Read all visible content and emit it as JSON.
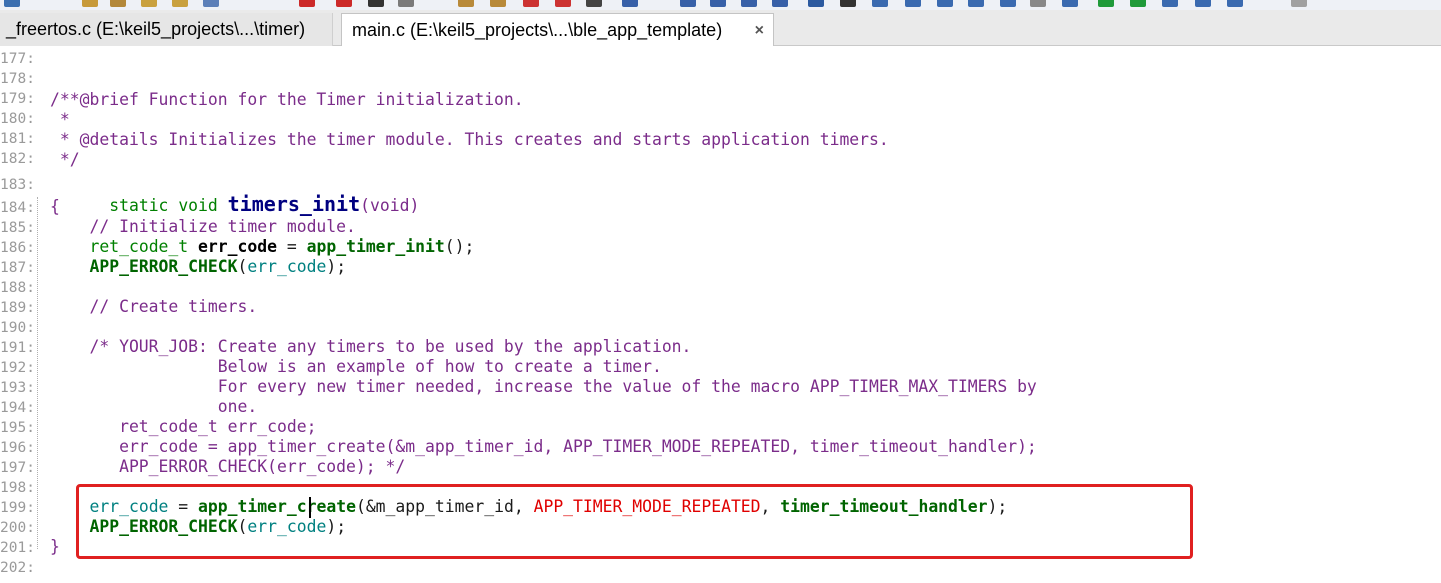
{
  "tabs": [
    {
      "label": "_freertos.c (E:\\keil5_projects\\...\\timer)",
      "active": false
    },
    {
      "label": "main.c (E:\\keil5_projects\\...\\ble_app_template)",
      "active": true,
      "close": "×"
    }
  ],
  "line_numbers": [
    "177:",
    "178:",
    "179:",
    "180:",
    "181:",
    "182:",
    "183:",
    "184:",
    "185:",
    "186:",
    "187:",
    "188:",
    "189:",
    "190:",
    "191:",
    "192:",
    "193:",
    "194:",
    "195:",
    "196:",
    "197:",
    "198:",
    "199:",
    "200:",
    "201:",
    "202:"
  ],
  "code": {
    "l179": "/**@brief Function for the Timer initialization.",
    "l180": " *",
    "l181": " * @details Initializes the timer module. This creates and starts application timers.",
    "l182": " */",
    "l183": {
      "kw1": "static",
      "kw2": "void",
      "fn": "timers_init",
      "p1": "(",
      "arg": "void",
      "p2": ")"
    },
    "l184": "{",
    "l185": "    // Initialize timer module.",
    "l186": {
      "indent": "    ",
      "type": "ret_code_t",
      "var": "err_code",
      "eq": " = ",
      "fn": "app_timer_init",
      "tail": "();"
    },
    "l187": {
      "indent": "    ",
      "fn": "APP_ERROR_CHECK",
      "p1": "(",
      "var": "err_code",
      "p2": ");"
    },
    "l189": "    // Create timers.",
    "l191": "    /* YOUR_JOB: Create any timers to be used by the application.",
    "l192": "                 Below is an example of how to create a timer.",
    "l193": "                 For every new timer needed, increase the value of the macro APP_TIMER_MAX_TIMERS by",
    "l194": "                 one.",
    "l195": "       ret_code_t err_code;",
    "l196": "       err_code = app_timer_create(&m_app_timer_id, APP_TIMER_MODE_REPEATED, timer_timeout_handler);",
    "l197": "       APP_ERROR_CHECK(err_code); */",
    "l199": {
      "indent": "    ",
      "var": "err_code",
      "eq": " = ",
      "fn": "app_timer_create",
      "p1": "(",
      "arg1": "&m_app_timer_id, ",
      "const": "APP_TIMER_MODE_REPEATED",
      "sep": ", ",
      "handler": "timer_timeout_handler",
      "p2": ");"
    },
    "l200": {
      "indent": "    ",
      "fn": "APP_ERROR_CHECK",
      "p1": "(",
      "var": "err_code",
      "p2": ");"
    },
    "l201": "}"
  },
  "colors": {
    "comment": "#7b2c8a",
    "keyword": "#008000",
    "function_def": "#000080",
    "function_call": "#006400",
    "variable": "#008080",
    "constant": "#e00000",
    "highlight_box": "#e02020"
  }
}
